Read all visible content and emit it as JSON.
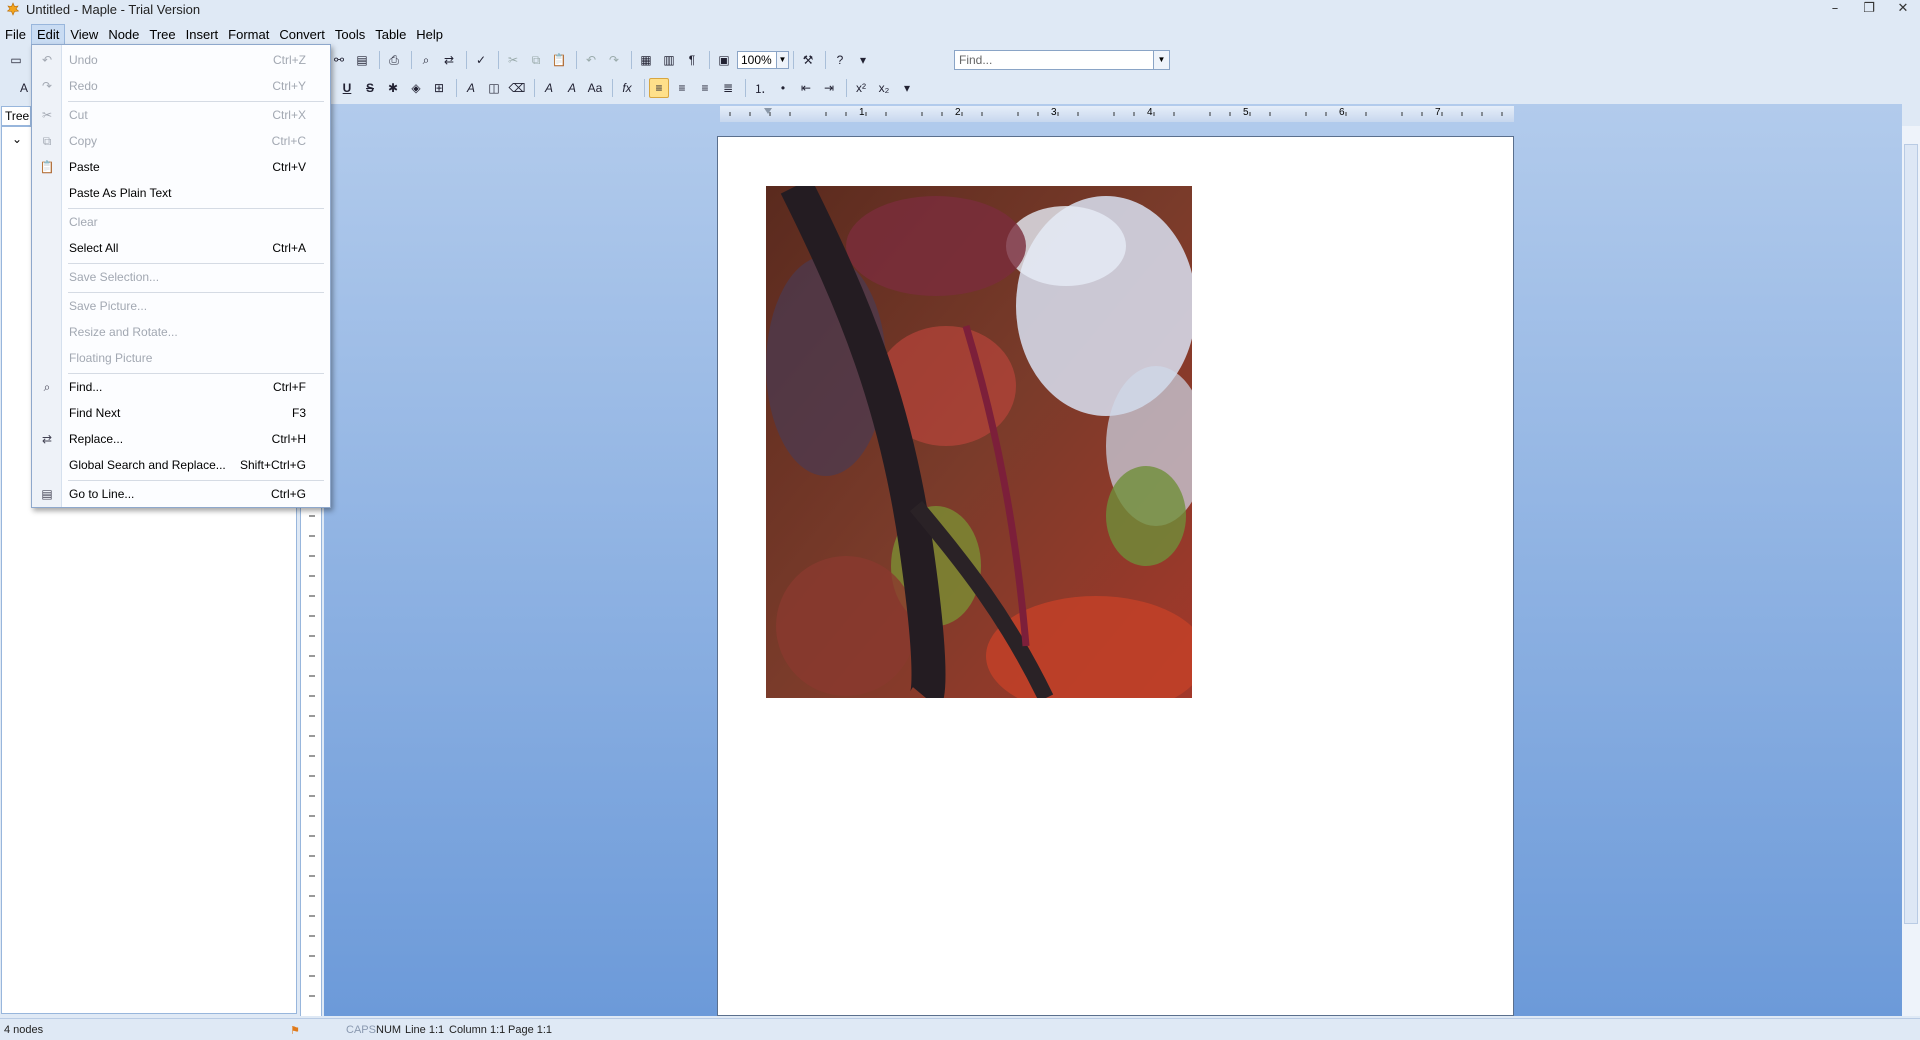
{
  "window": {
    "title": "Untitled - Maple - Trial Version",
    "controls": [
      "–",
      "❐",
      "✕"
    ]
  },
  "menubar": [
    "File",
    "Edit",
    "View",
    "Node",
    "Tree",
    "Insert",
    "Format",
    "Convert",
    "Tools",
    "Table",
    "Help"
  ],
  "toolbar": {
    "zoom": "100%",
    "find_placeholder": "Find..."
  },
  "tree": {
    "tab_label": "Tree"
  },
  "edit_menu": {
    "items": [
      {
        "label": "Undo",
        "shortcut": "Ctrl+Z",
        "enabled": false,
        "icon": "undo-icon"
      },
      {
        "label": "Redo",
        "shortcut": "Ctrl+Y",
        "enabled": false,
        "icon": "redo-icon"
      },
      {
        "label": "Cut",
        "shortcut": "Ctrl+X",
        "enabled": false,
        "icon": "cut-icon"
      },
      {
        "label": "Copy",
        "shortcut": "Ctrl+C",
        "enabled": false,
        "icon": "copy-icon"
      },
      {
        "label": "Paste",
        "shortcut": "Ctrl+V",
        "enabled": true,
        "icon": "paste-icon"
      },
      {
        "label": "Paste As Plain Text",
        "shortcut": "",
        "enabled": true,
        "icon": ""
      },
      {
        "label": "Clear",
        "shortcut": "",
        "enabled": false,
        "icon": ""
      },
      {
        "label": "Select All",
        "shortcut": "Ctrl+A",
        "enabled": true,
        "icon": ""
      },
      {
        "label": "Save Selection...",
        "shortcut": "",
        "enabled": false,
        "icon": ""
      },
      {
        "label": "Save Picture...",
        "shortcut": "",
        "enabled": false,
        "icon": ""
      },
      {
        "label": "Resize and Rotate...",
        "shortcut": "",
        "enabled": false,
        "icon": ""
      },
      {
        "label": "Floating Picture",
        "shortcut": "",
        "enabled": false,
        "icon": ""
      },
      {
        "label": "Find...",
        "shortcut": "Ctrl+F",
        "enabled": true,
        "icon": "binoculars-icon"
      },
      {
        "label": "Find Next",
        "shortcut": "F3",
        "enabled": true,
        "icon": ""
      },
      {
        "label": "Replace...",
        "shortcut": "Ctrl+H",
        "enabled": true,
        "icon": "replace-icon"
      },
      {
        "label": "Global Search and Replace...",
        "shortcut": "Shift+Ctrl+G",
        "enabled": true,
        "icon": ""
      },
      {
        "label": "Go to Line...",
        "shortcut": "Ctrl+G",
        "enabled": true,
        "icon": "goto-line-icon"
      }
    ]
  },
  "ruler": {
    "h_numbers": [
      "1",
      "2",
      "3",
      "4",
      "5",
      "6",
      "7"
    ],
    "v_numbers": [
      "4",
      "5",
      "6",
      "7",
      "8"
    ]
  },
  "status": {
    "nodes": "4 nodes",
    "caps": "CAPS",
    "num": "NUM",
    "line": "Line 1:1",
    "column": "Column 1:1",
    "page": "Page 1:1"
  },
  "colors": {
    "accent": "#c9dcf3",
    "doc_bg_top": "#b2cbec",
    "doc_bg_bottom": "#6c9ad9"
  }
}
